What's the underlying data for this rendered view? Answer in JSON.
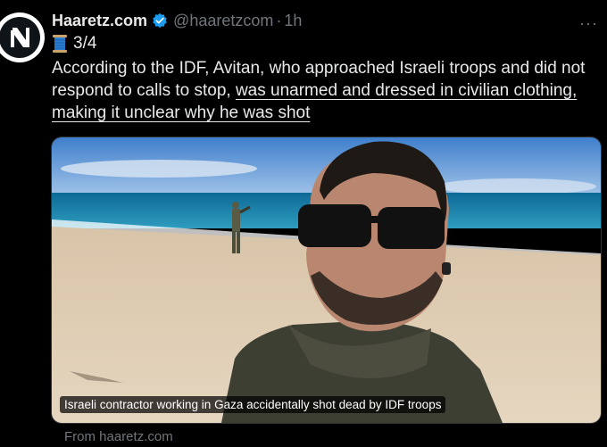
{
  "tweet": {
    "author_name": "Haaretz.com",
    "handle": "@haaretzcom",
    "separator": "·",
    "time": "1h",
    "more_label": "···",
    "thread_counter": "3/4",
    "text_plain": "According to the IDF, Avitan, who approached Israeli troops and did not respond to calls to stop, ",
    "text_link": "was unarmed and dressed in civilian clothing, making it unclear why he was shot ",
    "media_caption": "Israeli contractor working in Gaza accidentally shot dead by IDF troops",
    "source_label": "From haaretz.com"
  },
  "icons": {
    "avatar": "haaretz-logo-icon",
    "verified": "verified-badge-icon",
    "thread": "spool-of-thread-icon"
  },
  "colors": {
    "background": "#000000",
    "text_primary": "#e7e9ea",
    "text_secondary": "#71767b",
    "verified_blue": "#1d9bf0"
  }
}
